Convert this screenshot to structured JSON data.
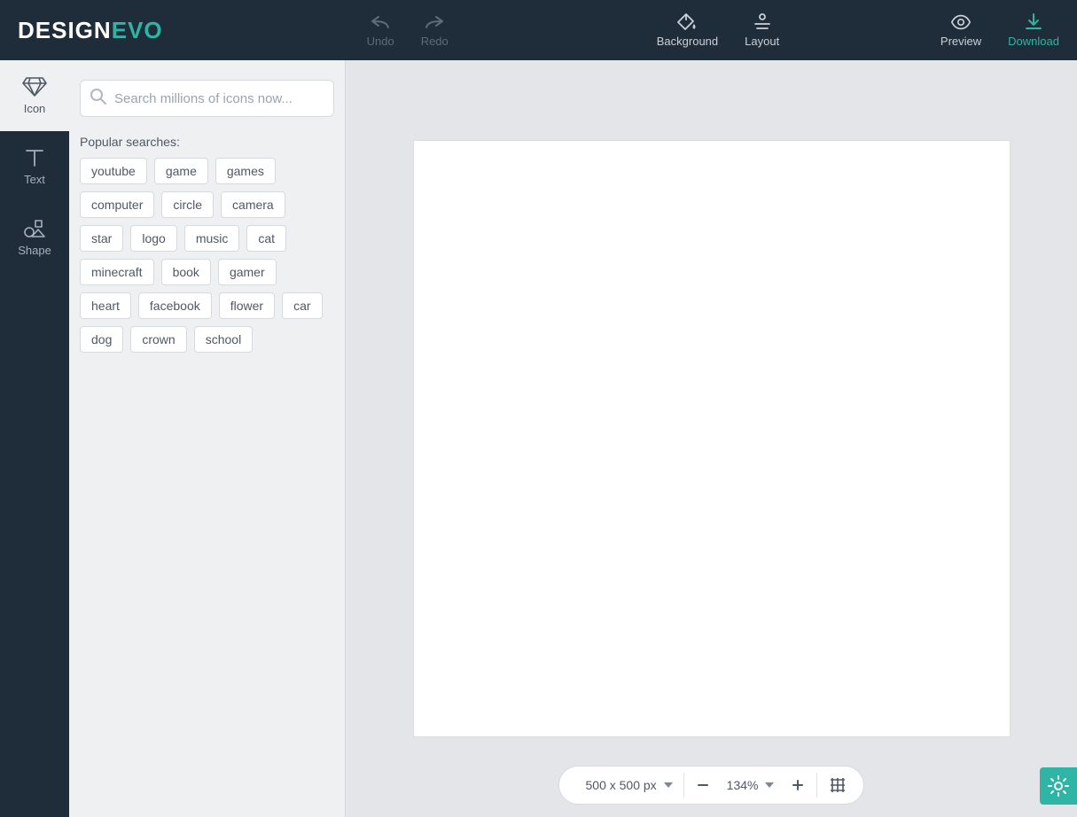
{
  "brand": {
    "part1": "DESIGN",
    "part2": "EVO"
  },
  "header": {
    "undo": "Undo",
    "redo": "Redo",
    "background": "Background",
    "layout": "Layout",
    "preview": "Preview",
    "download": "Download"
  },
  "nav": {
    "icon": "Icon",
    "text": "Text",
    "shape": "Shape"
  },
  "search": {
    "placeholder": "Search millions of icons now..."
  },
  "popular_label": "Popular searches:",
  "tags": [
    "youtube",
    "game",
    "games",
    "computer",
    "circle",
    "camera",
    "star",
    "logo",
    "music",
    "cat",
    "minecraft",
    "book",
    "gamer",
    "heart",
    "facebook",
    "flower",
    "car",
    "dog",
    "crown",
    "school"
  ],
  "bottom": {
    "size": "500 x 500 px",
    "zoom": "134%"
  }
}
